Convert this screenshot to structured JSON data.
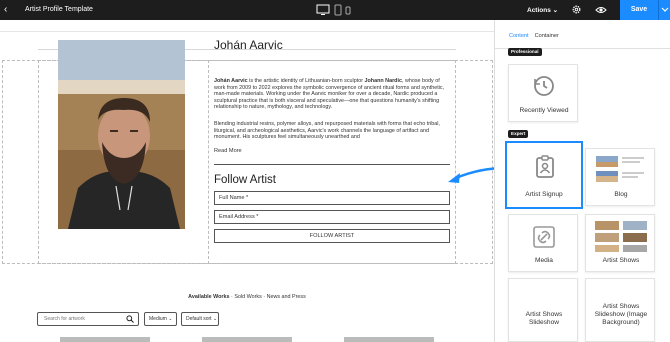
{
  "topbar": {
    "title": "Artist Profile Template",
    "actions_label": "Actions",
    "save_label": "Save"
  },
  "artist": {
    "name": "Johán Aarvic",
    "bio_p1_name": "Johán Aarvic",
    "bio_p1_a": " is the artistic identity of Lithuanian-born sculptor ",
    "bio_p1_name2": "Johann Nardic",
    "bio_p1_b": ", whose body of work from 2009 to 2022 explores the symbolic convergence of ancient ritual forms and synthetic, man-made materials. Working under the Aarvic moniker for over a decade, Nardic produced a sculptural practice that is both visceral and speculative—one that questions humanity's shifting relationship to nature, mythology, and technology.",
    "bio_p2": "Blending industrial resins, polymer alloys, and repurposed materials with forms that echo tribal, liturgical, and archeological aesthetics, Aarvic's work channels the language of artifact and monument. His sculptures feel simultaneously unearthed and",
    "read_more": "Read More",
    "follow_title": "Follow Artist",
    "full_name_placeholder": "Full Name *",
    "email_placeholder": "Email Address *",
    "follow_button": "FOLLOW ARTIST"
  },
  "works": {
    "tab_active": "Available Works",
    "tab_2": "Sold Works",
    "tab_3": "News and Press",
    "search_placeholder": "Search for artwork",
    "size_select": "Medium",
    "sort_select": "Default sort"
  },
  "panel": {
    "tab_content": "Content",
    "tab_container": "Container",
    "badge_professional": "Professional",
    "badge_expert": "Expert",
    "cards": {
      "recently_viewed": "Recently Viewed",
      "artist_signup": "Artist Signup",
      "blog": "Blog",
      "media": "Media",
      "artist_shows": "Artist Shows",
      "artist_shows_slideshow_l1": "Artist Shows",
      "artist_shows_slideshow_l2": "Slideshow",
      "artist_shows_slideshow_img_l1": "Artist Shows",
      "artist_shows_slideshow_img_l2": "Slideshow (Image",
      "artist_shows_slideshow_img_l3": "Background)"
    }
  },
  "colors": {
    "accent": "#1a8cff",
    "topbar": "#1d1d1d"
  }
}
